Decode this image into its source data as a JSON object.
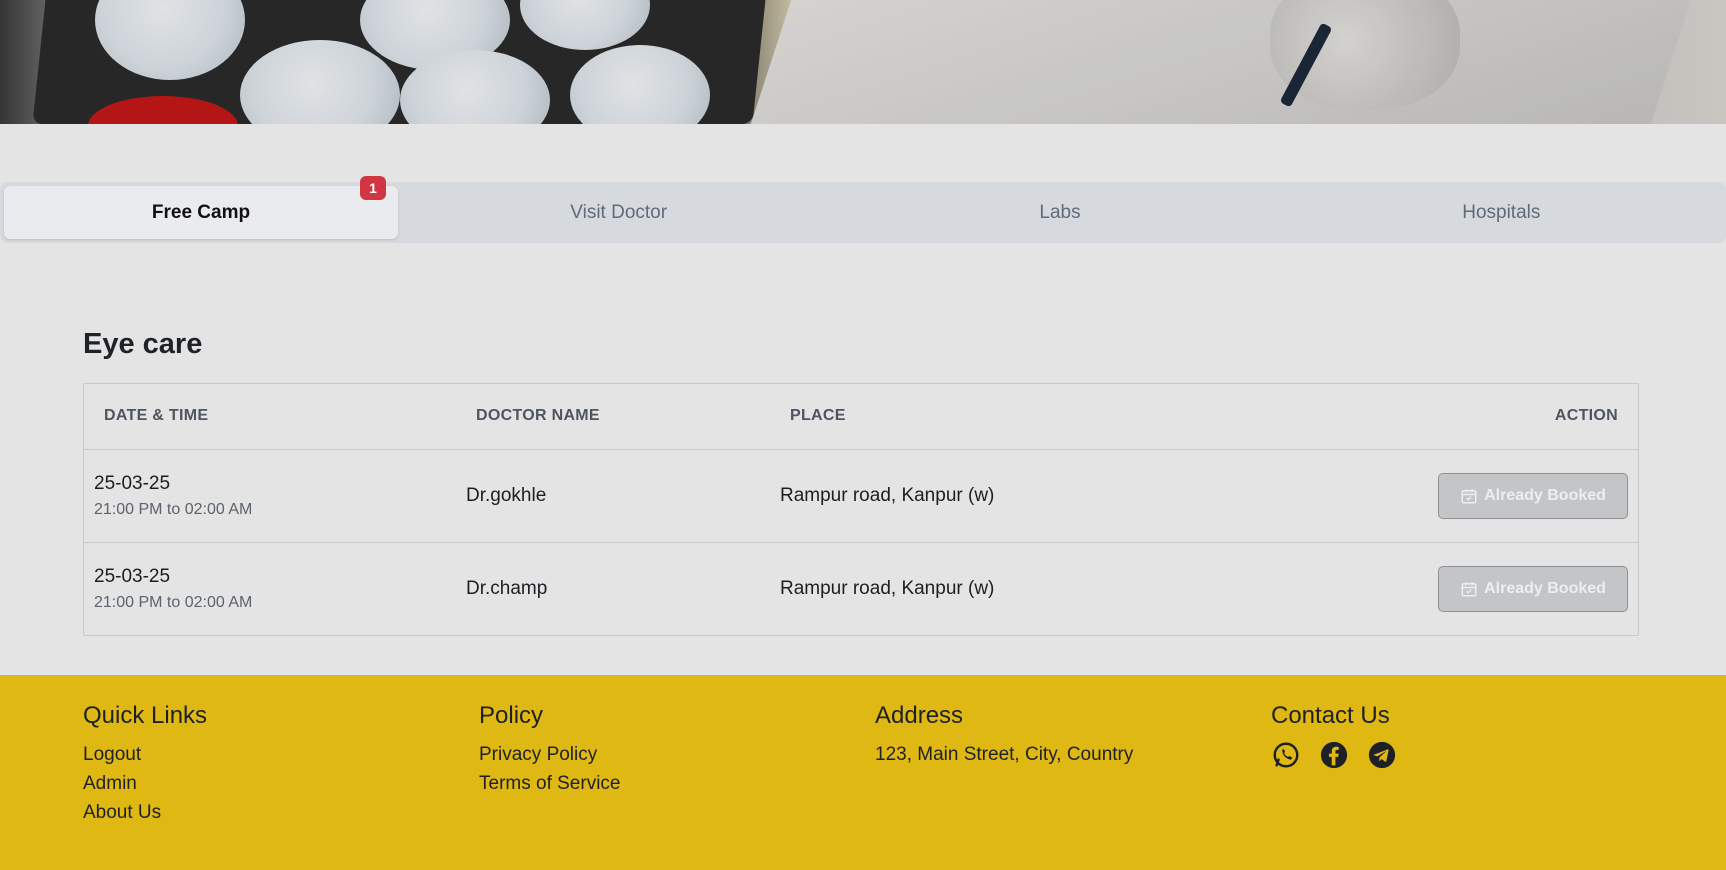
{
  "tabs": [
    {
      "label": "Free Camp",
      "active": true,
      "badge": "1"
    },
    {
      "label": "Visit Doctor",
      "active": false
    },
    {
      "label": "Labs",
      "active": false
    },
    {
      "label": "Hospitals",
      "active": false
    }
  ],
  "section": {
    "title": "Eye care"
  },
  "table": {
    "headers": [
      "DATE & TIME",
      "DOCTOR NAME",
      "PLACE",
      "ACTION"
    ],
    "rows": [
      {
        "date": "25-03-25",
        "time": "21:00 PM to 02:00 AM",
        "doctor": "Dr.gokhle",
        "place": "Rampur road, Kanpur (w)",
        "action": "Already Booked"
      },
      {
        "date": "25-03-25",
        "time": "21:00 PM to 02:00 AM",
        "doctor": "Dr.champ",
        "place": "Rampur road, Kanpur (w)",
        "action": "Already Booked"
      }
    ]
  },
  "footer": {
    "quick_links": {
      "title": "Quick Links",
      "items": [
        "Logout",
        "Admin",
        "About Us"
      ]
    },
    "policy": {
      "title": "Policy",
      "items": [
        "Privacy Policy",
        "Terms of Service"
      ]
    },
    "address": {
      "title": "Address",
      "text": "123, Main Street, City, Country"
    },
    "contact": {
      "title": "Contact Us",
      "icons": [
        "whatsapp-icon",
        "facebook-icon",
        "telegram-icon"
      ]
    }
  },
  "colors": {
    "page_bg": "#e4e4e4",
    "footer_bg": "#e0b814",
    "badge": "#d23643",
    "tab_bar": "#d6d9dd"
  }
}
